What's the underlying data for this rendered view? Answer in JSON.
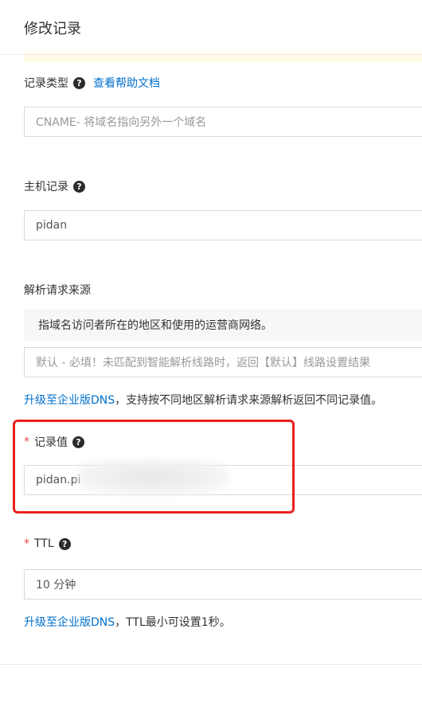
{
  "header": {
    "title": "修改记录"
  },
  "record_type": {
    "label": "记录类型",
    "help_link": "查看帮助文档",
    "value": "CNAME- 将域名指向另外一个域名"
  },
  "host_record": {
    "label": "主机记录",
    "value": "pidan"
  },
  "resolve_source": {
    "label": "解析请求来源",
    "description": "指域名访问者所在的地区和使用的运营商网络。",
    "value": "默认 - 必填！未匹配到智能解析线路时，返回【默认】线路设置结果",
    "upgrade_link": "升级至企业版DNS",
    "upgrade_hint": "，支持按不同地区解析请求来源解析返回不同记录值。"
  },
  "record_value": {
    "required_mark": "*",
    "label": "记录值",
    "value": "pidan.pi"
  },
  "ttl": {
    "required_mark": "*",
    "label": "TTL",
    "value": "10 分钟",
    "upgrade_link": "升级至企业版DNS",
    "upgrade_hint": "，TTL最小可设置1秒。"
  },
  "icons": {
    "help": "?"
  },
  "colors": {
    "link": "#0070cc",
    "required": "#e54545",
    "highlight_border": "#e8211b"
  }
}
